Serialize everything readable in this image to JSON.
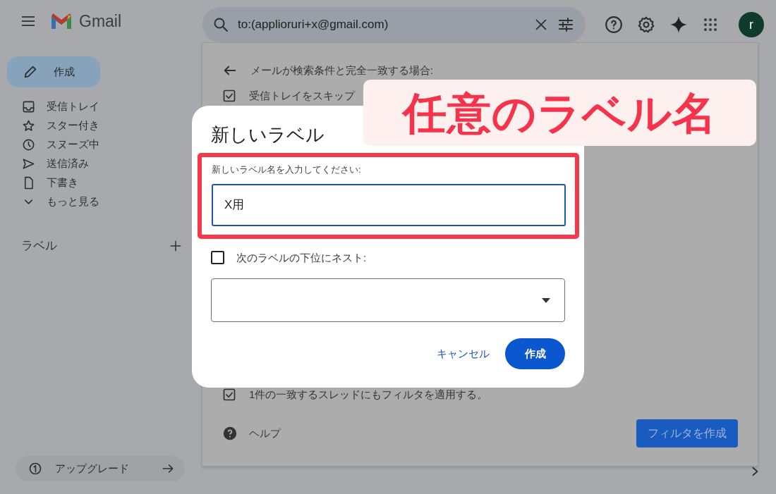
{
  "header": {
    "app_name": "Gmail",
    "search": {
      "value": "to:(applioruri+x@gmail.com)"
    },
    "avatar": {
      "initial": "r"
    }
  },
  "sidebar": {
    "compose": "作成",
    "items": [
      {
        "label": "受信トレイ"
      },
      {
        "label": "スター付き"
      },
      {
        "label": "スヌーズ中"
      },
      {
        "label": "送信済み"
      },
      {
        "label": "下書き"
      },
      {
        "label": "もっと見る"
      }
    ],
    "labels_heading": "ラベル",
    "upgrade": "アップグレード"
  },
  "filter_panel": {
    "heading": "メールが検索条件と完全一致する場合:",
    "options": [
      {
        "label": "受信トレイをスキップ",
        "checked": true
      },
      {
        "label": "1件の一致するスレッドにもフィルタを適用する。",
        "checked": true
      }
    ],
    "help": "ヘルプ",
    "create_filter_button": "フィルタを作成"
  },
  "dialog": {
    "title": "新しいラベル",
    "field_label": "新しいラベル名を入力してください:",
    "field_value": "X用",
    "nest": {
      "label": "次のラベルの下位にネスト:",
      "checked": false
    },
    "buttons": [
      {
        "label": "キャンセル",
        "kind": "text"
      },
      {
        "label": "作成",
        "kind": "filled"
      }
    ]
  },
  "callout": {
    "text": "任意のラベル名"
  }
}
